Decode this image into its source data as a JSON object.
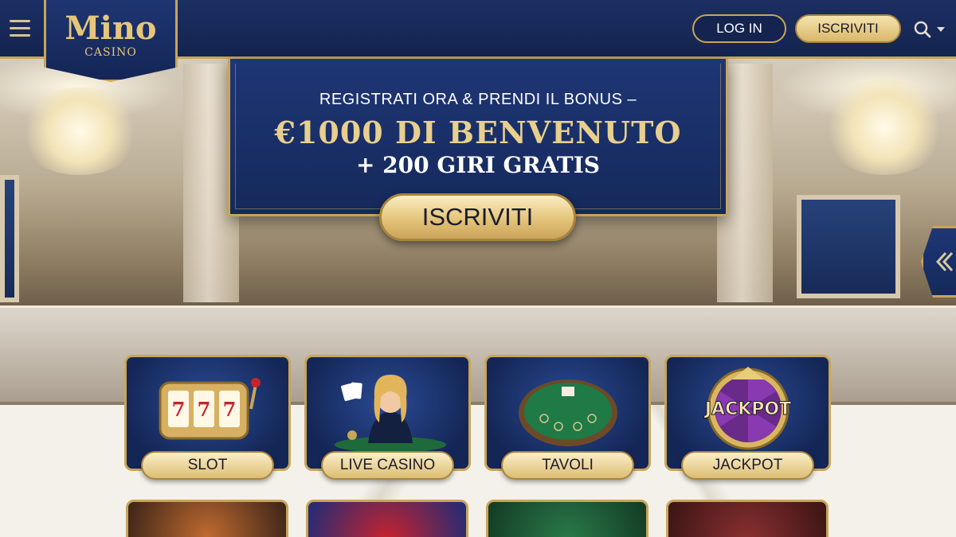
{
  "brand": {
    "name": "Mino",
    "sub": "CASINO"
  },
  "header": {
    "login_label": "LOG IN",
    "join_label": "ISCRIVITI"
  },
  "banner": {
    "line1": "REGISTRATI ORA & PRENDI IL BONUS –",
    "line2": "€1000 DI BENVENUTO",
    "line3": "+ 200 GIRI GRATIS",
    "cta_label": "ISCRIVITI"
  },
  "categories": [
    {
      "label": "SLOT",
      "icon": "slot-machine-icon"
    },
    {
      "label": "LIVE CASINO",
      "icon": "live-dealer-icon"
    },
    {
      "label": "TAVOLI",
      "icon": "card-table-icon"
    },
    {
      "label": "JACKPOT",
      "icon": "jackpot-wheel-icon",
      "badge": "JACKPOT"
    }
  ],
  "colors": {
    "navy": "#15295a",
    "gold": "#c9a55a",
    "cream": "#f5e4ae"
  }
}
